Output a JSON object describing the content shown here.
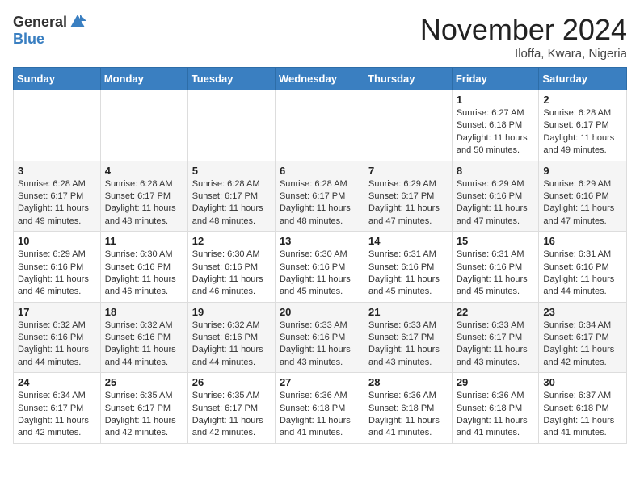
{
  "logo": {
    "general": "General",
    "blue": "Blue"
  },
  "title": "November 2024",
  "location": "Iloffa, Kwara, Nigeria",
  "headers": [
    "Sunday",
    "Monday",
    "Tuesday",
    "Wednesday",
    "Thursday",
    "Friday",
    "Saturday"
  ],
  "weeks": [
    [
      {
        "day": "",
        "info": ""
      },
      {
        "day": "",
        "info": ""
      },
      {
        "day": "",
        "info": ""
      },
      {
        "day": "",
        "info": ""
      },
      {
        "day": "",
        "info": ""
      },
      {
        "day": "1",
        "info": "Sunrise: 6:27 AM\nSunset: 6:18 PM\nDaylight: 11 hours and 50 minutes."
      },
      {
        "day": "2",
        "info": "Sunrise: 6:28 AM\nSunset: 6:17 PM\nDaylight: 11 hours and 49 minutes."
      }
    ],
    [
      {
        "day": "3",
        "info": "Sunrise: 6:28 AM\nSunset: 6:17 PM\nDaylight: 11 hours and 49 minutes."
      },
      {
        "day": "4",
        "info": "Sunrise: 6:28 AM\nSunset: 6:17 PM\nDaylight: 11 hours and 48 minutes."
      },
      {
        "day": "5",
        "info": "Sunrise: 6:28 AM\nSunset: 6:17 PM\nDaylight: 11 hours and 48 minutes."
      },
      {
        "day": "6",
        "info": "Sunrise: 6:28 AM\nSunset: 6:17 PM\nDaylight: 11 hours and 48 minutes."
      },
      {
        "day": "7",
        "info": "Sunrise: 6:29 AM\nSunset: 6:17 PM\nDaylight: 11 hours and 47 minutes."
      },
      {
        "day": "8",
        "info": "Sunrise: 6:29 AM\nSunset: 6:16 PM\nDaylight: 11 hours and 47 minutes."
      },
      {
        "day": "9",
        "info": "Sunrise: 6:29 AM\nSunset: 6:16 PM\nDaylight: 11 hours and 47 minutes."
      }
    ],
    [
      {
        "day": "10",
        "info": "Sunrise: 6:29 AM\nSunset: 6:16 PM\nDaylight: 11 hours and 46 minutes."
      },
      {
        "day": "11",
        "info": "Sunrise: 6:30 AM\nSunset: 6:16 PM\nDaylight: 11 hours and 46 minutes."
      },
      {
        "day": "12",
        "info": "Sunrise: 6:30 AM\nSunset: 6:16 PM\nDaylight: 11 hours and 46 minutes."
      },
      {
        "day": "13",
        "info": "Sunrise: 6:30 AM\nSunset: 6:16 PM\nDaylight: 11 hours and 45 minutes."
      },
      {
        "day": "14",
        "info": "Sunrise: 6:31 AM\nSunset: 6:16 PM\nDaylight: 11 hours and 45 minutes."
      },
      {
        "day": "15",
        "info": "Sunrise: 6:31 AM\nSunset: 6:16 PM\nDaylight: 11 hours and 45 minutes."
      },
      {
        "day": "16",
        "info": "Sunrise: 6:31 AM\nSunset: 6:16 PM\nDaylight: 11 hours and 44 minutes."
      }
    ],
    [
      {
        "day": "17",
        "info": "Sunrise: 6:32 AM\nSunset: 6:16 PM\nDaylight: 11 hours and 44 minutes."
      },
      {
        "day": "18",
        "info": "Sunrise: 6:32 AM\nSunset: 6:16 PM\nDaylight: 11 hours and 44 minutes."
      },
      {
        "day": "19",
        "info": "Sunrise: 6:32 AM\nSunset: 6:16 PM\nDaylight: 11 hours and 44 minutes."
      },
      {
        "day": "20",
        "info": "Sunrise: 6:33 AM\nSunset: 6:16 PM\nDaylight: 11 hours and 43 minutes."
      },
      {
        "day": "21",
        "info": "Sunrise: 6:33 AM\nSunset: 6:17 PM\nDaylight: 11 hours and 43 minutes."
      },
      {
        "day": "22",
        "info": "Sunrise: 6:33 AM\nSunset: 6:17 PM\nDaylight: 11 hours and 43 minutes."
      },
      {
        "day": "23",
        "info": "Sunrise: 6:34 AM\nSunset: 6:17 PM\nDaylight: 11 hours and 42 minutes."
      }
    ],
    [
      {
        "day": "24",
        "info": "Sunrise: 6:34 AM\nSunset: 6:17 PM\nDaylight: 11 hours and 42 minutes."
      },
      {
        "day": "25",
        "info": "Sunrise: 6:35 AM\nSunset: 6:17 PM\nDaylight: 11 hours and 42 minutes."
      },
      {
        "day": "26",
        "info": "Sunrise: 6:35 AM\nSunset: 6:17 PM\nDaylight: 11 hours and 42 minutes."
      },
      {
        "day": "27",
        "info": "Sunrise: 6:36 AM\nSunset: 6:18 PM\nDaylight: 11 hours and 41 minutes."
      },
      {
        "day": "28",
        "info": "Sunrise: 6:36 AM\nSunset: 6:18 PM\nDaylight: 11 hours and 41 minutes."
      },
      {
        "day": "29",
        "info": "Sunrise: 6:36 AM\nSunset: 6:18 PM\nDaylight: 11 hours and 41 minutes."
      },
      {
        "day": "30",
        "info": "Sunrise: 6:37 AM\nSunset: 6:18 PM\nDaylight: 11 hours and 41 minutes."
      }
    ]
  ]
}
